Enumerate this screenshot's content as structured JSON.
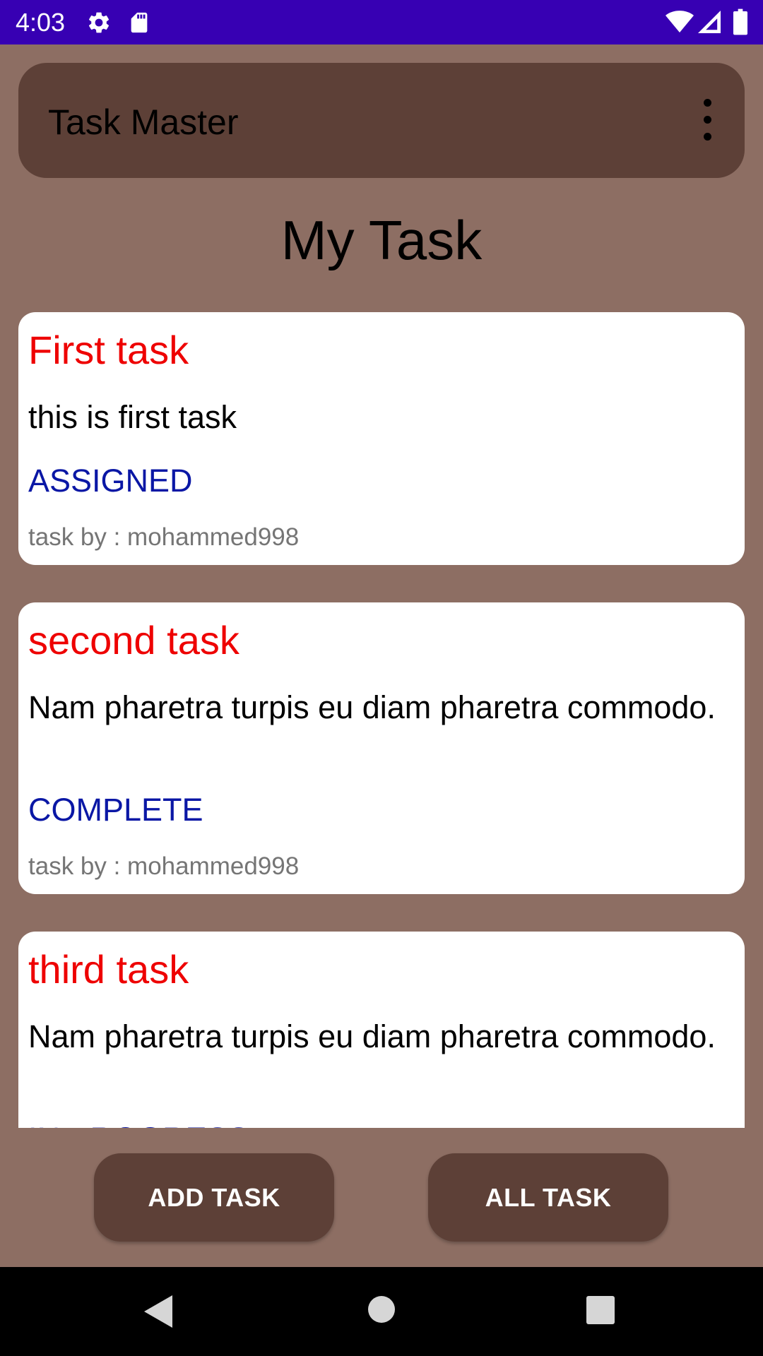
{
  "status_bar": {
    "time": "4:03",
    "left_icons": [
      "settings-icon",
      "sd-card-icon"
    ],
    "right_icons": [
      "wifi-icon",
      "signal-icon",
      "battery-icon"
    ],
    "background": "#3700b3"
  },
  "app_bar": {
    "title": "Task Master",
    "menu_icon": "more-vert-icon",
    "background": "#5d4037"
  },
  "page": {
    "heading": "My Task",
    "background": "#8d6e63"
  },
  "tasks": [
    {
      "title": "First task",
      "body": "this is first task",
      "state": "ASSIGNED",
      "author": "task by : mohammed998"
    },
    {
      "title": "second task",
      "body": "Nam pharetra turpis eu diam pharetra commodo.",
      "state": "COMPLETE",
      "author": "task by : mohammed998"
    },
    {
      "title": "third task",
      "body": "Nam pharetra turpis eu diam pharetra commodo.",
      "state": "IN PROGRESS",
      "author": ""
    }
  ],
  "actions": {
    "add_task": "ADD TASK",
    "all_task": "ALL TASK"
  },
  "nav_bar": {
    "buttons": [
      "back-icon",
      "home-icon",
      "recents-icon"
    ]
  },
  "colors": {
    "task_title": "#ee0000",
    "task_state": "#0a17a5",
    "task_author": "#757575"
  }
}
